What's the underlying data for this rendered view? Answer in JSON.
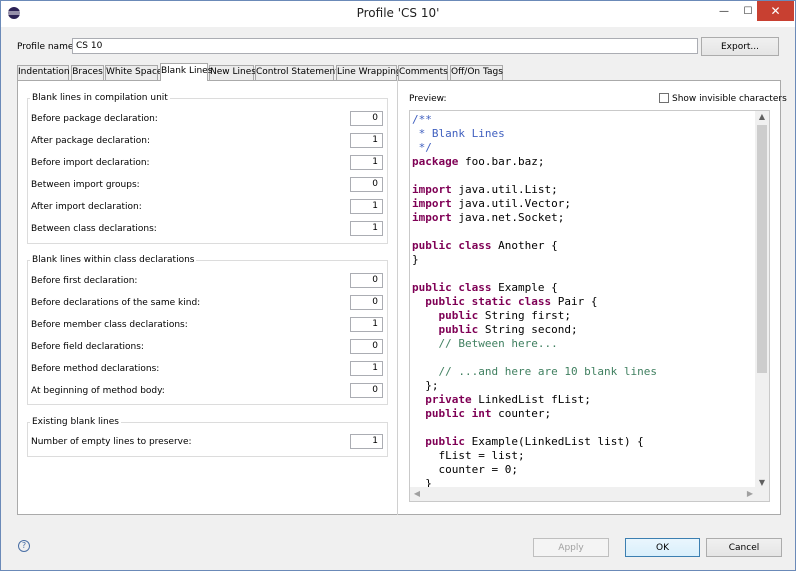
{
  "window": {
    "title": "Profile 'CS 10'",
    "minimize": "—",
    "maximize": "☐",
    "close": "✕"
  },
  "profile": {
    "label": "Profile name:",
    "value": "CS 10",
    "export_label": "Export..."
  },
  "tabs": [
    {
      "label": "Indentation",
      "active": false
    },
    {
      "label": "Braces",
      "active": false
    },
    {
      "label": "White Space",
      "active": false
    },
    {
      "label": "Blank Lines",
      "active": true
    },
    {
      "label": "New Lines",
      "active": false
    },
    {
      "label": "Control Statements",
      "active": false
    },
    {
      "label": "Line Wrapping",
      "active": false
    },
    {
      "label": "Comments",
      "active": false
    },
    {
      "label": "Off/On Tags",
      "active": false
    }
  ],
  "groups": {
    "compilation_unit": {
      "title": "Blank lines in compilation unit",
      "rows": [
        {
          "label": "Before package declaration:",
          "value": "0"
        },
        {
          "label": "After package declaration:",
          "value": "1"
        },
        {
          "label": "Before import declaration:",
          "value": "1"
        },
        {
          "label": "Between import groups:",
          "value": "0"
        },
        {
          "label": "After import declaration:",
          "value": "1"
        },
        {
          "label": "Between class declarations:",
          "value": "1"
        }
      ]
    },
    "class_declarations": {
      "title": "Blank lines within class declarations",
      "rows": [
        {
          "label": "Before first declaration:",
          "value": "0"
        },
        {
          "label": "Before declarations of the same kind:",
          "value": "0"
        },
        {
          "label": "Before member class declarations:",
          "value": "1"
        },
        {
          "label": "Before field declarations:",
          "value": "0"
        },
        {
          "label": "Before method declarations:",
          "value": "1"
        },
        {
          "label": "At beginning of method body:",
          "value": "0"
        }
      ]
    },
    "existing": {
      "title": "Existing blank lines",
      "rows": [
        {
          "label": "Number of empty lines to preserve:",
          "value": "1"
        }
      ]
    }
  },
  "preview": {
    "label": "Preview:",
    "show_invisible_label": "Show invisible characters",
    "show_invisible_checked": false,
    "code_lines": [
      [
        {
          "t": "/**",
          "c": "cm"
        }
      ],
      [
        {
          "t": " * Blank Lines",
          "c": "cm"
        }
      ],
      [
        {
          "t": " */",
          "c": "cm"
        }
      ],
      [
        {
          "t": "package",
          "c": "kw"
        },
        {
          "t": " foo.bar.baz;",
          "c": ""
        }
      ],
      [
        {
          "t": "",
          "c": ""
        }
      ],
      [
        {
          "t": "import",
          "c": "kw"
        },
        {
          "t": " java.util.List;",
          "c": ""
        }
      ],
      [
        {
          "t": "import",
          "c": "kw"
        },
        {
          "t": " java.util.Vector;",
          "c": ""
        }
      ],
      [
        {
          "t": "import",
          "c": "kw"
        },
        {
          "t": " java.net.Socket;",
          "c": ""
        }
      ],
      [
        {
          "t": "",
          "c": ""
        }
      ],
      [
        {
          "t": "public class",
          "c": "kw"
        },
        {
          "t": " Another {",
          "c": ""
        }
      ],
      [
        {
          "t": "}",
          "c": ""
        }
      ],
      [
        {
          "t": "",
          "c": ""
        }
      ],
      [
        {
          "t": "public class",
          "c": "kw"
        },
        {
          "t": " Example {",
          "c": ""
        }
      ],
      [
        {
          "t": "  ",
          "c": ""
        },
        {
          "t": "public static class",
          "c": "kw"
        },
        {
          "t": " Pair {",
          "c": ""
        }
      ],
      [
        {
          "t": "    ",
          "c": ""
        },
        {
          "t": "public",
          "c": "kw"
        },
        {
          "t": " String first;",
          "c": ""
        }
      ],
      [
        {
          "t": "    ",
          "c": ""
        },
        {
          "t": "public",
          "c": "kw"
        },
        {
          "t": " String second;",
          "c": ""
        }
      ],
      [
        {
          "t": "    // Between here...",
          "c": "lc"
        }
      ],
      [
        {
          "t": "",
          "c": ""
        }
      ],
      [
        {
          "t": "    // ...and here are 10 blank lines",
          "c": "lc"
        }
      ],
      [
        {
          "t": "  };",
          "c": ""
        }
      ],
      [
        {
          "t": "  ",
          "c": ""
        },
        {
          "t": "private",
          "c": "kw"
        },
        {
          "t": " LinkedList fList;",
          "c": ""
        }
      ],
      [
        {
          "t": "  ",
          "c": ""
        },
        {
          "t": "public int",
          "c": "kw"
        },
        {
          "t": " counter;",
          "c": ""
        }
      ],
      [
        {
          "t": "",
          "c": ""
        }
      ],
      [
        {
          "t": "  ",
          "c": ""
        },
        {
          "t": "public",
          "c": "kw"
        },
        {
          "t": " Example(LinkedList list) {",
          "c": ""
        }
      ],
      [
        {
          "t": "    fList = list;",
          "c": ""
        }
      ],
      [
        {
          "t": "    counter = 0;",
          "c": ""
        }
      ],
      [
        {
          "t": "  }",
          "c": ""
        }
      ]
    ]
  },
  "footer": {
    "help": "?",
    "apply_label": "Apply",
    "ok_label": "OK",
    "cancel_label": "Cancel"
  }
}
